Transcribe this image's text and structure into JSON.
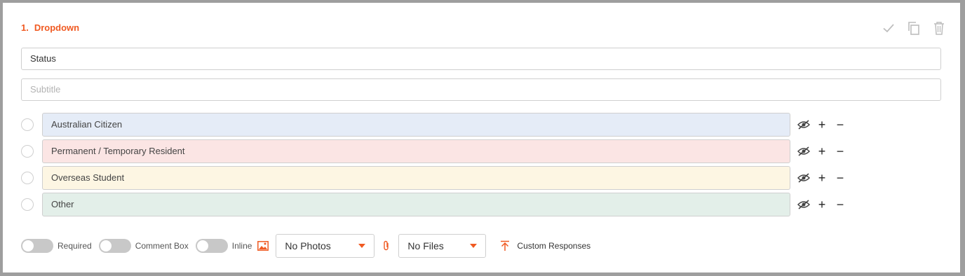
{
  "question": {
    "number": "1.",
    "title": "Dropdown"
  },
  "header_icons": [
    "check-icon",
    "copy-icon",
    "trash-icon"
  ],
  "title_field": {
    "value": "Status"
  },
  "subtitle_field": {
    "placeholder": "Subtitle"
  },
  "options": [
    {
      "label": "Australian Citizen",
      "color": "#e5ecf7"
    },
    {
      "label": "Permanent / Temporary Resident",
      "color": "#fbe5e4"
    },
    {
      "label": "Overseas Student",
      "color": "#fdf6e3"
    },
    {
      "label": "Other",
      "color": "#e3efe9"
    }
  ],
  "option_action_icons": [
    "eye-slash-icon",
    "plus-icon",
    "minus-icon"
  ],
  "footer": {
    "required_label": "Required",
    "comment_box_label": "Comment Box",
    "inline_label": "Inline",
    "photos_select": "No Photos",
    "files_select": "No Files",
    "custom_responses_label": "Custom Responses"
  },
  "colors": {
    "accent": "#f05a22",
    "border": "#cfcfcf",
    "toggle_off": "#c8c8c8"
  }
}
